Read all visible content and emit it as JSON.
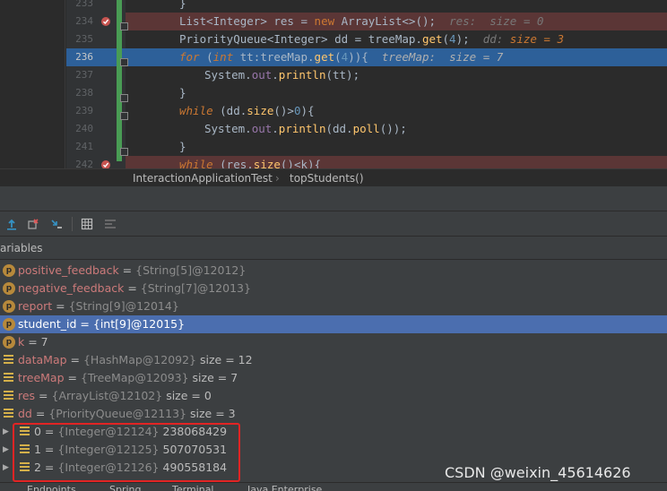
{
  "editor": {
    "lines": [
      {
        "num": "233",
        "code": "}",
        "type": "normal"
      },
      {
        "num": "234",
        "code": "List<Integer> res = new ArrayList<>();",
        "hint": "res:  size = 0",
        "type": "breakpoint"
      },
      {
        "num": "235",
        "code": "PriorityQueue<Integer> dd = treeMap.get(4);",
        "hint_name": "dd:",
        "hint_val": "size = 3",
        "type": "normal"
      },
      {
        "num": "236",
        "code": "for (int tt:treeMap.get(4)){",
        "hint": "treeMap:  size = 7",
        "type": "execution"
      },
      {
        "num": "237",
        "code": "System.out.println(tt);",
        "type": "normal"
      },
      {
        "num": "238",
        "code": "}",
        "type": "normal"
      },
      {
        "num": "239",
        "code": "while (dd.size()>0){",
        "type": "normal"
      },
      {
        "num": "240",
        "code": "System.out.println(dd.poll());",
        "type": "normal"
      },
      {
        "num": "241",
        "code": "}",
        "type": "normal"
      },
      {
        "num": "242",
        "code": "while (res.size()<k){",
        "type": "breakpoint"
      }
    ]
  },
  "breadcrumb": {
    "items": [
      "InteractionApplicationTest",
      "topStudents()"
    ],
    "separator": "›"
  },
  "debug": {
    "variables_title": "ariables",
    "variables": [
      {
        "name": "positive_feedback",
        "ref": "{String[5]@12012}",
        "extra": "",
        "icon": "p",
        "selected": false
      },
      {
        "name": "negative_feedback",
        "ref": "{String[7]@12013}",
        "extra": "",
        "icon": "p",
        "selected": false
      },
      {
        "name": "report",
        "ref": "{String[9]@12014}",
        "extra": "",
        "icon": "p",
        "selected": false
      },
      {
        "name": "student_id",
        "ref": "{int[9]@12015}",
        "extra": "",
        "icon": "p",
        "selected": true
      },
      {
        "name": "k",
        "ref": "",
        "extra": "7",
        "icon": "p",
        "selected": false
      },
      {
        "name": "dataMap",
        "ref": "{HashMap@12092}",
        "extra": "size = 12",
        "icon": "eq",
        "selected": false
      },
      {
        "name": "treeMap",
        "ref": "{TreeMap@12093}",
        "extra": "size = 7",
        "icon": "eq",
        "selected": false
      },
      {
        "name": "res",
        "ref": "{ArrayList@12102}",
        "extra": "size = 0",
        "icon": "eq",
        "selected": false
      },
      {
        "name": "dd",
        "ref": "{PriorityQueue@12113}",
        "extra": "size = 3",
        "icon": "eq",
        "selected": false
      }
    ],
    "children": [
      {
        "name": "0",
        "ref": "{Integer@12124}",
        "value": "238068429"
      },
      {
        "name": "1",
        "ref": "{Integer@12125}",
        "value": "507070531"
      },
      {
        "name": "2",
        "ref": "{Integer@12126}",
        "value": "490558184"
      }
    ]
  },
  "bottom_tabs": [
    "Endpoints",
    "Spring",
    "Terminal",
    "Java Enterprise"
  ],
  "watermark": "CSDN @weixin_45614626",
  "colors": {
    "breakpoint_line": "#5b3636",
    "execution_line": "#2d6099",
    "selected_row": "#4b6eaf",
    "highlight_box": "#e22424"
  }
}
